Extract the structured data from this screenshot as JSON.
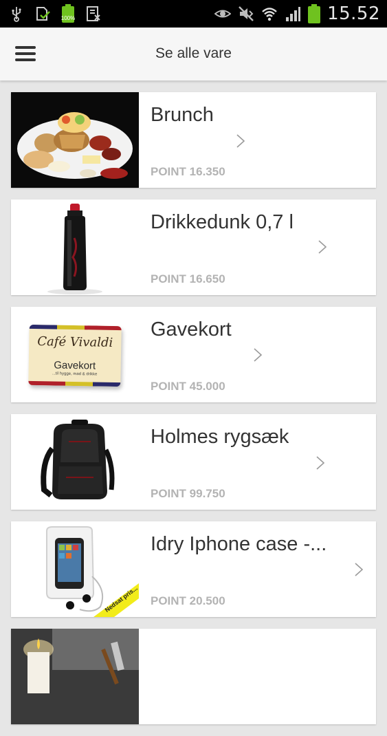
{
  "status_bar": {
    "time": "15.52",
    "battery_label": "100%",
    "left_icons": [
      "usb-icon",
      "download-complete-icon",
      "battery-full-icon",
      "nfc-icon"
    ],
    "right_icons": [
      "eye-icon",
      "mute-icon",
      "wifi-icon",
      "signal-icon",
      "battery-icon"
    ]
  },
  "header": {
    "title": "Se alle vare",
    "menu_icon": "hamburger-menu-icon"
  },
  "products": [
    {
      "name": "Brunch",
      "points": "POINT 16.350",
      "image": "brunch-plate"
    },
    {
      "name": "Drikkedunk 0,7 l",
      "points": "POINT 16.650",
      "image": "water-bottle"
    },
    {
      "name": "Gavekort",
      "points": "POINT 45.000",
      "image": "gift-card",
      "image_text": {
        "brand": "Café Vivaldi",
        "label": "Gavekort",
        "sub": "...til hygge, mad & drikke"
      }
    },
    {
      "name": "Holmes rygsæk",
      "points": "POINT 99.750",
      "image": "backpack"
    },
    {
      "name": "Idry Iphone case -...",
      "points": "POINT 20.500",
      "image": "iphone-case",
      "image_text": {
        "banner": "Nedsat pris..."
      }
    },
    {
      "name": "",
      "points": "",
      "image": "candle-coffee"
    }
  ],
  "colors": {
    "background": "#e6e6e6",
    "card": "#ffffff",
    "title": "#333333",
    "points": "#b3b3b3",
    "status_bar": "#000000",
    "battery_green": "#6fc21f"
  }
}
